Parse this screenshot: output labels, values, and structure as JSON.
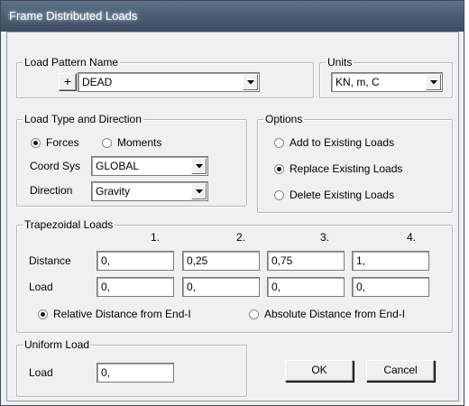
{
  "window": {
    "title": "Frame Distributed Loads"
  },
  "load_pattern": {
    "legend": "Load Pattern Name",
    "plus_label": "+",
    "value": "DEAD"
  },
  "units": {
    "legend": "Units",
    "value": "KN, m, C"
  },
  "load_type": {
    "legend": "Load Type and Direction",
    "forces_label": "Forces",
    "moments_label": "Moments",
    "selected": "Forces",
    "coord_sys_label": "Coord Sys",
    "coord_sys_value": "GLOBAL",
    "direction_label": "Direction",
    "direction_value": "Gravity"
  },
  "options": {
    "legend": "Options",
    "add_label": "Add to Existing Loads",
    "replace_label": "Replace Existing Loads",
    "delete_label": "Delete Existing Loads",
    "selected": "Replace Existing Loads"
  },
  "trapezoidal": {
    "legend": "Trapezoidal Loads",
    "columns": [
      "1.",
      "2.",
      "3.",
      "4."
    ],
    "distance_label": "Distance",
    "load_label": "Load",
    "distances": [
      "0,",
      "0,25",
      "0,75",
      "1,"
    ],
    "loads": [
      "0,",
      "0,",
      "0,",
      "0,"
    ],
    "relative_label": "Relative Distance from End-I",
    "absolute_label": "Absolute Distance from End-I",
    "selected": "Relative Distance from End-I"
  },
  "uniform": {
    "legend": "Uniform Load",
    "load_label": "Load",
    "value": "0,"
  },
  "buttons": {
    "ok": "OK",
    "cancel": "Cancel"
  },
  "icons": {
    "dropdown": "chevron-down-icon",
    "radio_selected": "radio-selected",
    "radio_unselected": "radio-unselected"
  },
  "colors": {
    "titlebar": "#4d5f73",
    "dialog_bg": "#f0f0f0",
    "field_bg": "#ffffff"
  }
}
